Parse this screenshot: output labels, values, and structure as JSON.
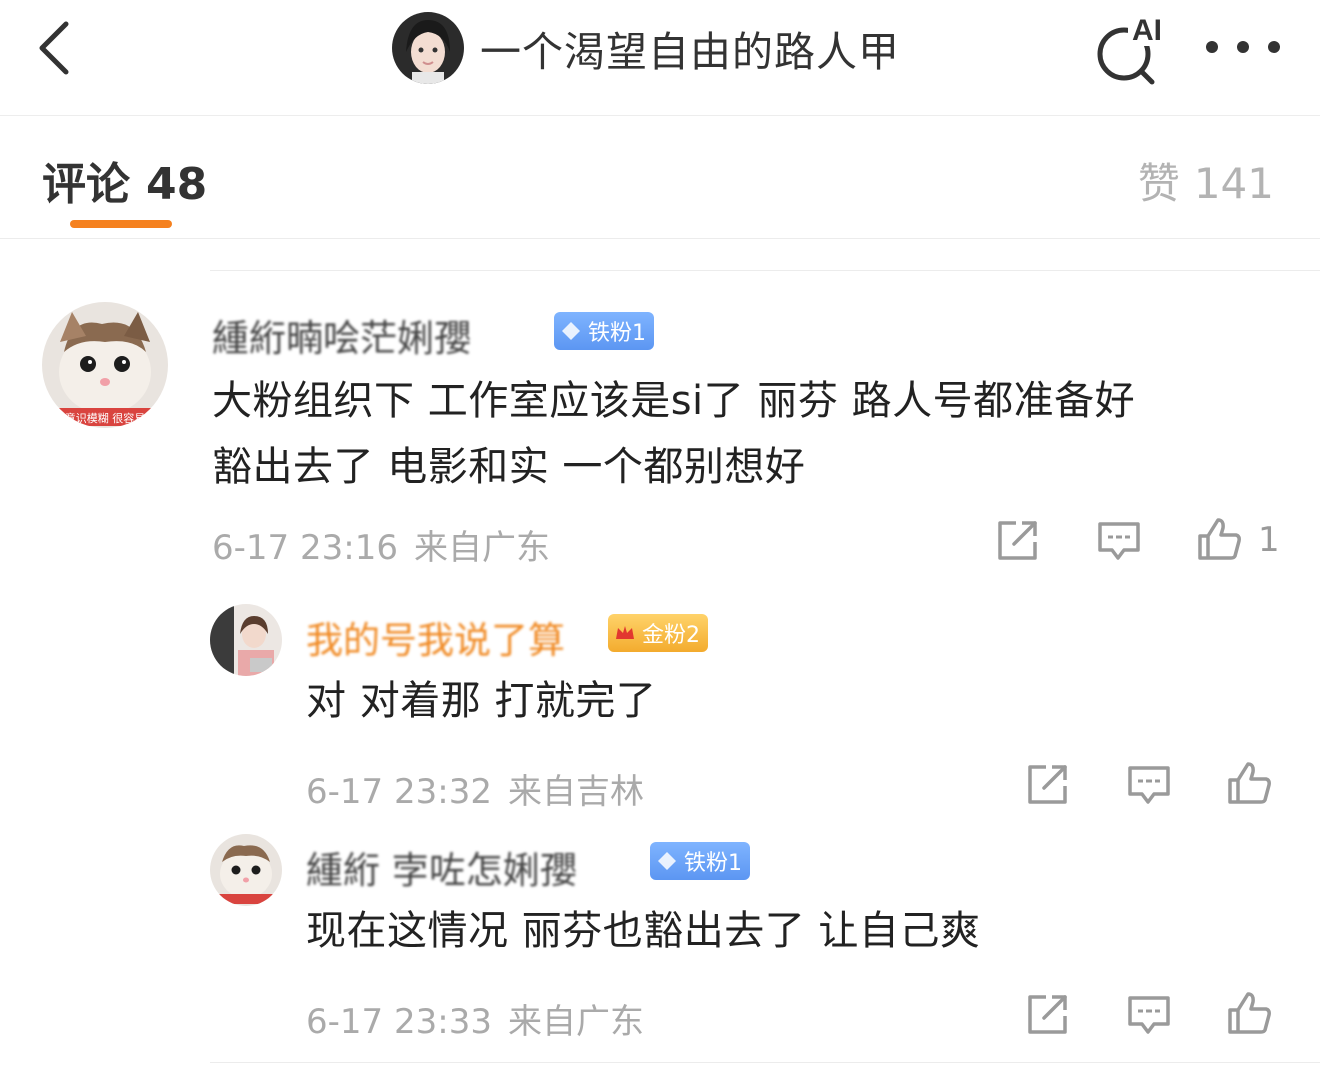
{
  "header": {
    "author_name": "一个渴望自由的路人甲",
    "ai_label": "AI"
  },
  "tabs": {
    "comments_label": "评论",
    "comments_count": "48",
    "likes_label": "赞",
    "likes_count": "141"
  },
  "colors": {
    "accent": "#f5811f",
    "muted": "#aaaaaa",
    "iron_badge": "#6aa3f7",
    "gold_badge": "#f5b93c",
    "gold_username": "#f08a24"
  },
  "comments": [
    {
      "username": "緟絎暔哙茫娳孾",
      "badge": "铁粉1",
      "text_lines": [
        "大粉组织下  工作室应该是si了  丽芬 路人号都准备好",
        "豁出去了  电影和实     一个都别想好"
      ],
      "time": "6-17 23:16",
      "location": "来自广东",
      "like_count": "1",
      "replies": [
        {
          "username": "我的号我说了算",
          "badge": "金粉2",
          "text": "对 对着那   打就完了",
          "time": "6-17 23:32",
          "location": "来自吉林"
        },
        {
          "username": "緟絎 孛咗怎娳孾",
          "badge": "铁粉1",
          "text": "现在这情况  丽芬也豁出去了  让自己爽",
          "time": "6-17 23:33",
          "location": "来自广东"
        }
      ]
    }
  ],
  "icons": [
    "back-arrow-icon",
    "ai-search-icon",
    "more-icon",
    "share-icon",
    "reply-icon",
    "thumbs-up-icon"
  ]
}
